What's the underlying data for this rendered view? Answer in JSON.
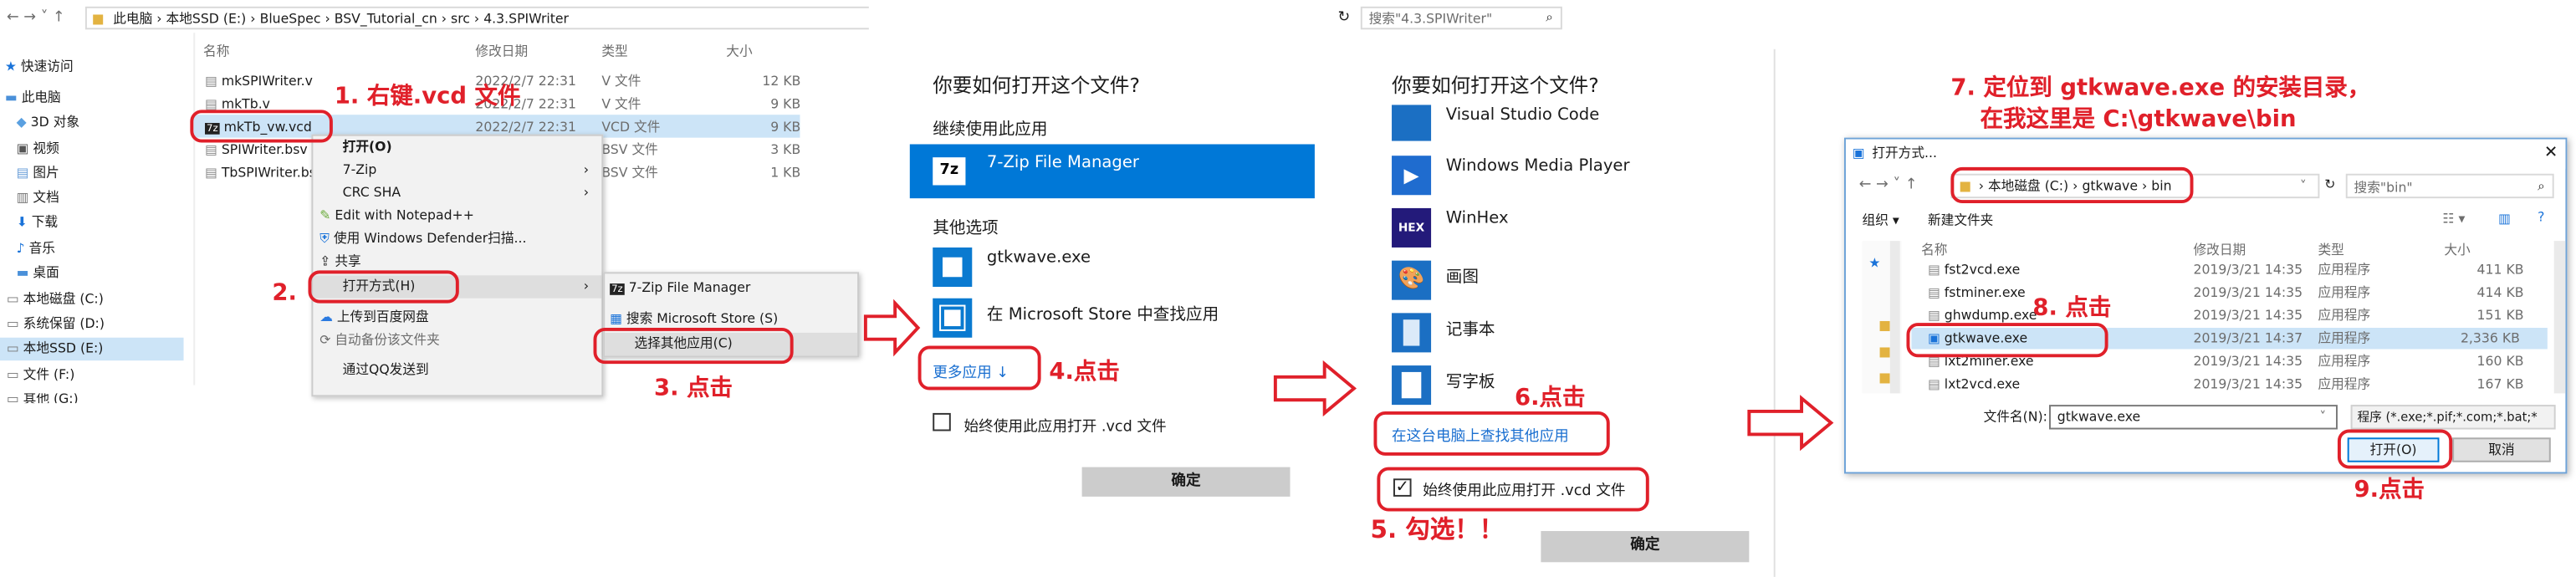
{
  "explorer": {
    "address": [
      "此电脑",
      "本地SSD (E:)",
      "BlueSpec",
      "BSV_Tutorial_cn",
      "src",
      "4.3.SPIWriter"
    ],
    "search_placeholder": "搜索\"4.3.SPIWriter\"",
    "columns": [
      "名称",
      "修改日期",
      "类型",
      "大小"
    ],
    "sidebar": [
      "快速访问",
      "此电脑",
      "3D 对象",
      "视频",
      "图片",
      "文档",
      "下载",
      "音乐",
      "桌面",
      "本地磁盘 (C:)",
      "系统保留 (D:)",
      "本地SSD (E:)",
      "文件 (F:)",
      "其他 (G:)"
    ],
    "files": [
      {
        "name": "mkSPIWriter.v",
        "date": "2022/2/7 22:31",
        "type": "V 文件",
        "size": "12 KB"
      },
      {
        "name": "mkTb.v",
        "date": "2022/2/7 22:31",
        "type": "V 文件",
        "size": "9 KB"
      },
      {
        "name": "mkTb_vw.vcd",
        "date": "2022/2/7 22:31",
        "type": "VCD 文件",
        "size": "9 KB"
      },
      {
        "name": "SPIWriter.bsv",
        "date": "",
        "type": "BSV 文件",
        "size": "3 KB"
      },
      {
        "name": "TbSPIWriter.bsv",
        "date": "",
        "type": "BSV 文件",
        "size": "1 KB"
      }
    ],
    "context_menu": [
      "打开(O)",
      "7-Zip",
      "CRC SHA",
      "Edit with Notepad++",
      "使用 Windows Defender扫描...",
      "共享",
      "打开方式(H)",
      "上传到百度网盘",
      "自动备份该文件夹",
      "通过QQ发送到"
    ],
    "submenu": [
      "7-Zip File Manager",
      "搜索 Microsoft Store (S)",
      "选择其他应用(C)"
    ]
  },
  "dialog1": {
    "title": "你要如何打开这个文件?",
    "continue_label": "继续使用此应用",
    "selected_app": "7-Zip File Manager",
    "other_label": "其他选项",
    "apps": [
      "gtkwave.exe",
      "在 Microsoft Store 中查找应用"
    ],
    "more_link": "更多应用 ↓",
    "always_label": "始终使用此应用打开 .vcd 文件",
    "ok": "确定"
  },
  "dialog2": {
    "title": "你要如何打开这个文件?",
    "apps": [
      "Visual Studio Code",
      "Windows Media Player",
      "WinHex",
      "画图",
      "记事本",
      "写字板"
    ],
    "find_link": "在这台电脑上查找其他应用",
    "always_label": "始终使用此应用打开 .vcd 文件",
    "ok": "确定"
  },
  "openwith": {
    "title": "打开方式...",
    "path": [
      "本地磁盘 (C:)",
      "gtkwave",
      "bin"
    ],
    "search_placeholder": "搜索\"bin\"",
    "organize": "组织 ▾",
    "new_folder": "新建文件夹",
    "columns": [
      "名称",
      "修改日期",
      "类型",
      "大小"
    ],
    "files": [
      {
        "name": "fst2vcd.exe",
        "date": "2019/3/21 14:35",
        "type": "应用程序",
        "size": "411 KB"
      },
      {
        "name": "fstminer.exe",
        "date": "2019/3/21 14:35",
        "type": "应用程序",
        "size": "414 KB"
      },
      {
        "name": "ghwdump.exe",
        "date": "2019/3/21 14:35",
        "type": "应用程序",
        "size": "151 KB"
      },
      {
        "name": "gtkwave.exe",
        "date": "2019/3/21 14:37",
        "type": "应用程序",
        "size": "2,336 KB"
      },
      {
        "name": "lxt2miner.exe",
        "date": "2019/3/21 14:35",
        "type": "应用程序",
        "size": "160 KB"
      },
      {
        "name": "lxt2vcd.exe",
        "date": "2019/3/21 14:35",
        "type": "应用程序",
        "size": "167 KB"
      }
    ],
    "filename_label": "文件名(N):",
    "filename_value": "gtkwave.exe",
    "filter": "程序 (*.exe;*.pif;*.com;*.bat;*",
    "open": "打开(O)",
    "cancel": "取消"
  },
  "annotations": {
    "a1": "1. 右键.vcd 文件",
    "a2": "2.",
    "a3": "3. 点击",
    "a4": "4.点击",
    "a5": "5. 勾选！！",
    "a6": "6.点击",
    "a7a": "7. 定位到 gtkwave.exe 的安装目录，",
    "a7b": "在我这里是 C:\\gtkwave\\bin",
    "a8": "8. 点击",
    "a9": "9.点击"
  }
}
